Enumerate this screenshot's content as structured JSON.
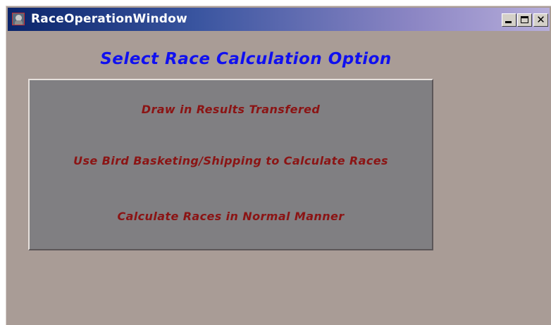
{
  "window": {
    "title": "RaceOperationWindow",
    "icon": "app-icon",
    "controls": {
      "minimize": "minimize-icon",
      "maximize": "maximize-icon",
      "close": "close-icon",
      "close_glyph": "✕"
    }
  },
  "main": {
    "heading": "Select Race Calculation Option",
    "options": [
      {
        "label": "Draw in Results Transfered"
      },
      {
        "label": "Use Bird Basketing/Shipping to Calculate Races"
      },
      {
        "label": "Calculate Races in Normal Manner"
      }
    ]
  },
  "colors": {
    "background": "#a99c96",
    "panel": "#807f82",
    "heading": "#1010f0",
    "option_text": "#8b1414",
    "titlebar_start": "#0a246a",
    "titlebar_end": "#b7aedb"
  }
}
